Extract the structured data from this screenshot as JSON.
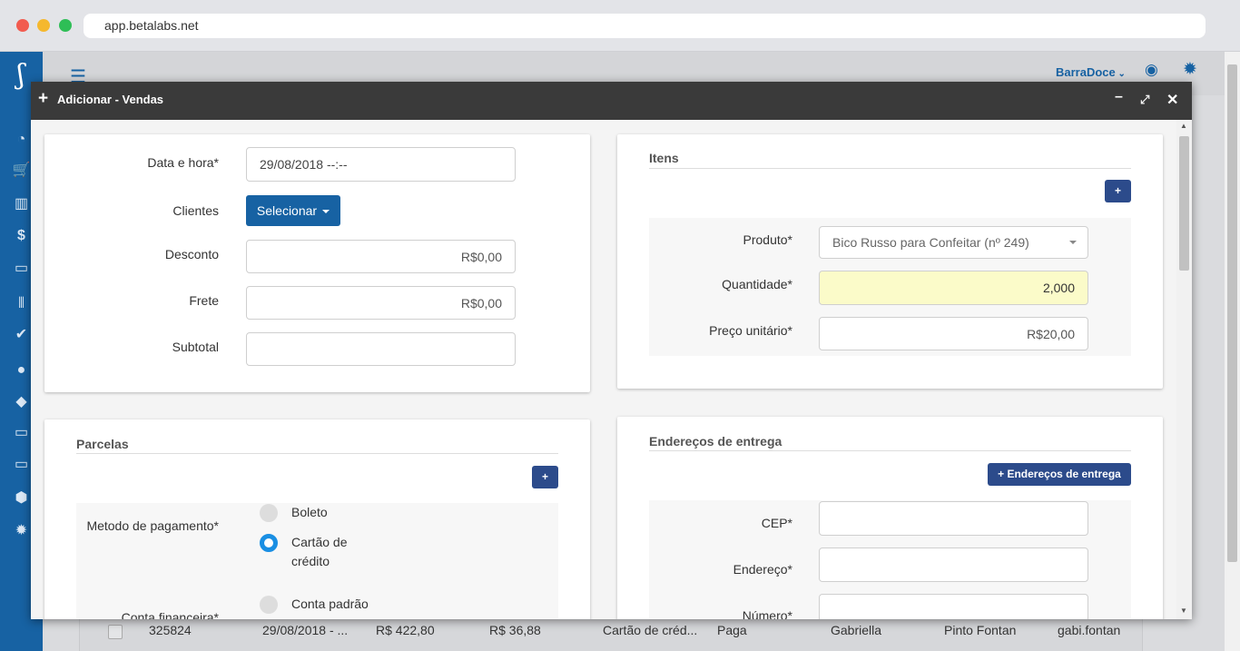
{
  "browser": {
    "url": "app.betalabs.net"
  },
  "app": {
    "company": "BarraDoce",
    "sidebar_icons": [
      "dashboard-icon",
      "cart-icon",
      "chart-icon",
      "dollar-icon",
      "card-icon",
      "barcode-icon",
      "check-icon",
      "user-icon",
      "tags-icon",
      "monitor-icon",
      "desktop-icon",
      "box-icon",
      "settings-icon"
    ]
  },
  "background_row": {
    "id": "325824",
    "date": "29/08/2018 - ...",
    "total": "R$ 422,80",
    "shipping": "R$ 36,88",
    "payment": "Cartão de créd...",
    "status": "Paga",
    "first_name": "Gabriella",
    "last_name": "Pinto Fontan",
    "user": "gabi.fontan"
  },
  "modal": {
    "title": "Adicionar - Vendas",
    "general": {
      "date_label": "Data e hora*",
      "date_value": "29/08/2018  --:--",
      "clients_label": "Clientes",
      "clients_button": "Selecionar",
      "discount_label": "Desconto",
      "discount_value": "R$0,00",
      "freight_label": "Frete",
      "freight_value": "R$0,00",
      "subtotal_label": "Subtotal",
      "subtotal_value": ""
    },
    "items": {
      "title": "Itens",
      "add_button": "+",
      "product_label": "Produto*",
      "product_value": "Bico Russo para Confeitar (nº 249)",
      "quantity_label": "Quantidade*",
      "quantity_value": "2,000",
      "unit_price_label": "Preço unitário*",
      "unit_price_value": "R$20,00"
    },
    "installments": {
      "title": "Parcelas",
      "add_button": "+",
      "payment_method_label": "Metodo de pagamento*",
      "options": [
        "Boleto",
        "Cartão de crédito"
      ],
      "selected": "Cartão de crédito",
      "account_label": "Conta financeira*",
      "account_option": "Conta padrão"
    },
    "delivery": {
      "title": "Endereços de entrega",
      "add_button": "+ Endereços de entrega",
      "cep_label": "CEP*",
      "address_label": "Endereço*",
      "number_label": "Número*"
    }
  }
}
